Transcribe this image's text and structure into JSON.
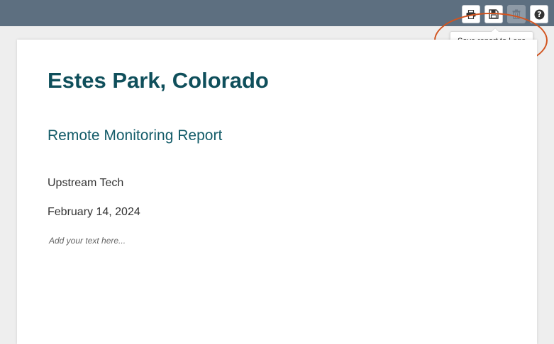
{
  "toolbar": {
    "print": {
      "icon": "printer-icon"
    },
    "save": {
      "icon": "floppy-disk-icon",
      "tooltip": "Save report to Lens"
    },
    "delete": {
      "icon": "trash-icon",
      "state": "disabled"
    },
    "help": {
      "icon": "question-mark-icon"
    }
  },
  "report": {
    "title": "Estes Park, Colorado",
    "subtitle": "Remote Monitoring Report",
    "organization": "Upstream Tech",
    "date": "February 14, 2024",
    "text_placeholder": "Add your text here..."
  },
  "colors": {
    "topbar": "#5d6f80",
    "title": "#0f4f5b",
    "subtitle": "#145c69",
    "annotation": "#d2541f"
  }
}
